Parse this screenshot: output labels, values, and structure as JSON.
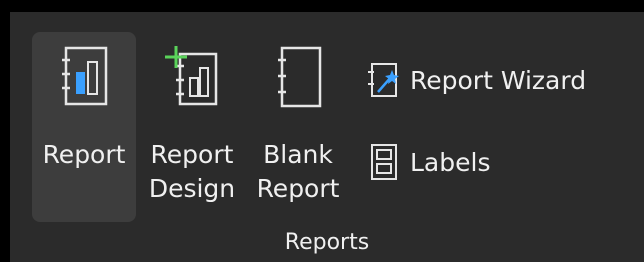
{
  "ribbon": {
    "group_label": "Reports",
    "buttons": {
      "report": {
        "label": "Report",
        "icon": "report-icon",
        "selected": true
      },
      "report_design": {
        "label_line1": "Report",
        "label_line2": "Design",
        "icon": "report-design-icon"
      },
      "blank_report": {
        "label_line1": "Blank",
        "label_line2": "Report",
        "icon": "blank-report-icon"
      }
    },
    "small_buttons": {
      "report_wizard": {
        "label": "Report Wizard",
        "icon": "report-wizard-icon"
      },
      "labels": {
        "label": "Labels",
        "icon": "labels-icon"
      }
    }
  },
  "colors": {
    "background": "#2b2b2b",
    "selected": "#3d3d3d",
    "accent_blue": "#3aa0ff",
    "accent_green": "#5ad35a",
    "icon_stroke": "#e6e6e6"
  }
}
